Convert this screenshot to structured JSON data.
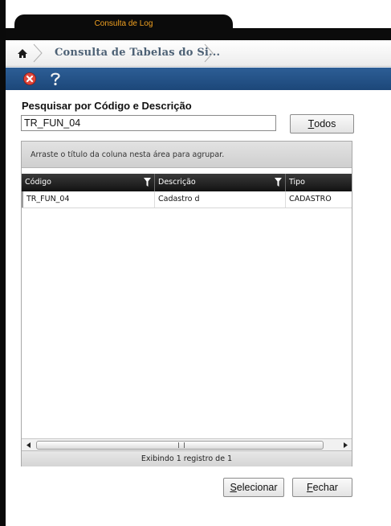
{
  "window": {
    "tab_title": "Consulta de Log"
  },
  "breadcrumb": {
    "label": "Consulta de Tabelas do Si..."
  },
  "icons": {
    "home": "home-icon",
    "close": "close-icon",
    "help": "help-icon",
    "filter": "filter-icon"
  },
  "colors": {
    "tab_title": "#f0a020",
    "toolbar": "#1c4779",
    "crumb_text": "#4d6175",
    "close_icon": "#e0463a"
  },
  "search": {
    "label": "Pesquisar por Código e Descrição",
    "value": "TR_FUN_04",
    "todos_first": "T",
    "todos_rest": "odos"
  },
  "grid": {
    "group_hint": "Arraste o título da coluna nesta área para agrupar.",
    "columns": [
      "Código",
      "Descrição",
      "Tipo"
    ],
    "rows": [
      [
        "TR_FUN_04",
        "Cadastro d",
        "CADASTRO"
      ]
    ],
    "footer": "Exibindo 1 registro de 1"
  },
  "actions": {
    "selecionar_first": "S",
    "selecionar_rest": "elecionar",
    "fechar_first": "F",
    "fechar_rest": "echar"
  }
}
